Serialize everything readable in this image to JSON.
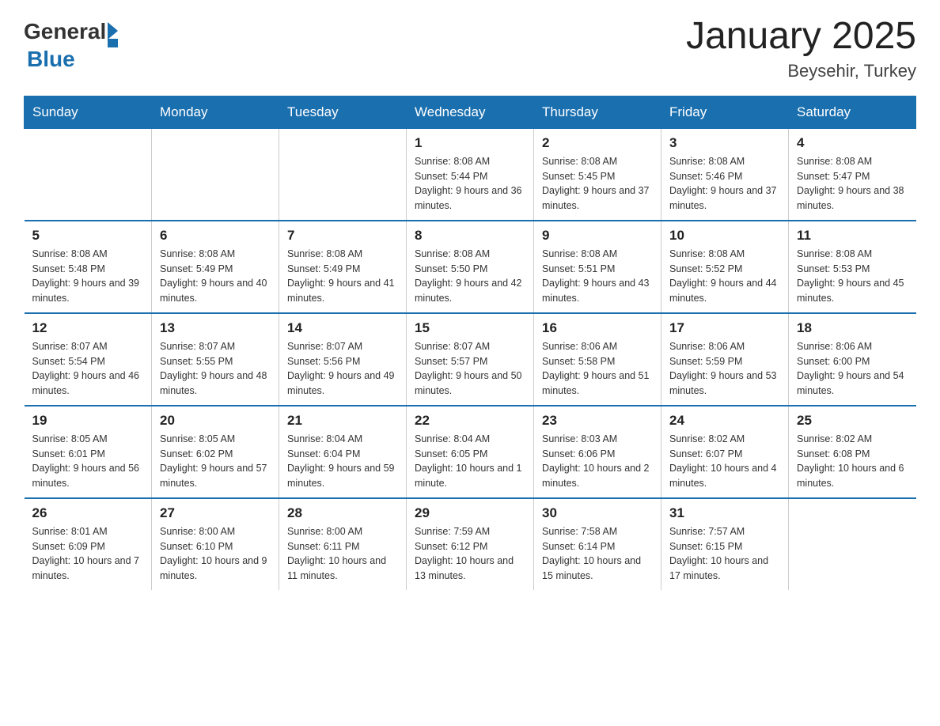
{
  "header": {
    "logo_general": "General",
    "logo_blue": "Blue",
    "month_title": "January 2025",
    "location": "Beysehir, Turkey"
  },
  "days_of_week": [
    "Sunday",
    "Monday",
    "Tuesday",
    "Wednesday",
    "Thursday",
    "Friday",
    "Saturday"
  ],
  "weeks": [
    [
      {
        "day": "",
        "info": ""
      },
      {
        "day": "",
        "info": ""
      },
      {
        "day": "",
        "info": ""
      },
      {
        "day": "1",
        "info": "Sunrise: 8:08 AM\nSunset: 5:44 PM\nDaylight: 9 hours and 36 minutes."
      },
      {
        "day": "2",
        "info": "Sunrise: 8:08 AM\nSunset: 5:45 PM\nDaylight: 9 hours and 37 minutes."
      },
      {
        "day": "3",
        "info": "Sunrise: 8:08 AM\nSunset: 5:46 PM\nDaylight: 9 hours and 37 minutes."
      },
      {
        "day": "4",
        "info": "Sunrise: 8:08 AM\nSunset: 5:47 PM\nDaylight: 9 hours and 38 minutes."
      }
    ],
    [
      {
        "day": "5",
        "info": "Sunrise: 8:08 AM\nSunset: 5:48 PM\nDaylight: 9 hours and 39 minutes."
      },
      {
        "day": "6",
        "info": "Sunrise: 8:08 AM\nSunset: 5:49 PM\nDaylight: 9 hours and 40 minutes."
      },
      {
        "day": "7",
        "info": "Sunrise: 8:08 AM\nSunset: 5:49 PM\nDaylight: 9 hours and 41 minutes."
      },
      {
        "day": "8",
        "info": "Sunrise: 8:08 AM\nSunset: 5:50 PM\nDaylight: 9 hours and 42 minutes."
      },
      {
        "day": "9",
        "info": "Sunrise: 8:08 AM\nSunset: 5:51 PM\nDaylight: 9 hours and 43 minutes."
      },
      {
        "day": "10",
        "info": "Sunrise: 8:08 AM\nSunset: 5:52 PM\nDaylight: 9 hours and 44 minutes."
      },
      {
        "day": "11",
        "info": "Sunrise: 8:08 AM\nSunset: 5:53 PM\nDaylight: 9 hours and 45 minutes."
      }
    ],
    [
      {
        "day": "12",
        "info": "Sunrise: 8:07 AM\nSunset: 5:54 PM\nDaylight: 9 hours and 46 minutes."
      },
      {
        "day": "13",
        "info": "Sunrise: 8:07 AM\nSunset: 5:55 PM\nDaylight: 9 hours and 48 minutes."
      },
      {
        "day": "14",
        "info": "Sunrise: 8:07 AM\nSunset: 5:56 PM\nDaylight: 9 hours and 49 minutes."
      },
      {
        "day": "15",
        "info": "Sunrise: 8:07 AM\nSunset: 5:57 PM\nDaylight: 9 hours and 50 minutes."
      },
      {
        "day": "16",
        "info": "Sunrise: 8:06 AM\nSunset: 5:58 PM\nDaylight: 9 hours and 51 minutes."
      },
      {
        "day": "17",
        "info": "Sunrise: 8:06 AM\nSunset: 5:59 PM\nDaylight: 9 hours and 53 minutes."
      },
      {
        "day": "18",
        "info": "Sunrise: 8:06 AM\nSunset: 6:00 PM\nDaylight: 9 hours and 54 minutes."
      }
    ],
    [
      {
        "day": "19",
        "info": "Sunrise: 8:05 AM\nSunset: 6:01 PM\nDaylight: 9 hours and 56 minutes."
      },
      {
        "day": "20",
        "info": "Sunrise: 8:05 AM\nSunset: 6:02 PM\nDaylight: 9 hours and 57 minutes."
      },
      {
        "day": "21",
        "info": "Sunrise: 8:04 AM\nSunset: 6:04 PM\nDaylight: 9 hours and 59 minutes."
      },
      {
        "day": "22",
        "info": "Sunrise: 8:04 AM\nSunset: 6:05 PM\nDaylight: 10 hours and 1 minute."
      },
      {
        "day": "23",
        "info": "Sunrise: 8:03 AM\nSunset: 6:06 PM\nDaylight: 10 hours and 2 minutes."
      },
      {
        "day": "24",
        "info": "Sunrise: 8:02 AM\nSunset: 6:07 PM\nDaylight: 10 hours and 4 minutes."
      },
      {
        "day": "25",
        "info": "Sunrise: 8:02 AM\nSunset: 6:08 PM\nDaylight: 10 hours and 6 minutes."
      }
    ],
    [
      {
        "day": "26",
        "info": "Sunrise: 8:01 AM\nSunset: 6:09 PM\nDaylight: 10 hours and 7 minutes."
      },
      {
        "day": "27",
        "info": "Sunrise: 8:00 AM\nSunset: 6:10 PM\nDaylight: 10 hours and 9 minutes."
      },
      {
        "day": "28",
        "info": "Sunrise: 8:00 AM\nSunset: 6:11 PM\nDaylight: 10 hours and 11 minutes."
      },
      {
        "day": "29",
        "info": "Sunrise: 7:59 AM\nSunset: 6:12 PM\nDaylight: 10 hours and 13 minutes."
      },
      {
        "day": "30",
        "info": "Sunrise: 7:58 AM\nSunset: 6:14 PM\nDaylight: 10 hours and 15 minutes."
      },
      {
        "day": "31",
        "info": "Sunrise: 7:57 AM\nSunset: 6:15 PM\nDaylight: 10 hours and 17 minutes."
      },
      {
        "day": "",
        "info": ""
      }
    ]
  ]
}
